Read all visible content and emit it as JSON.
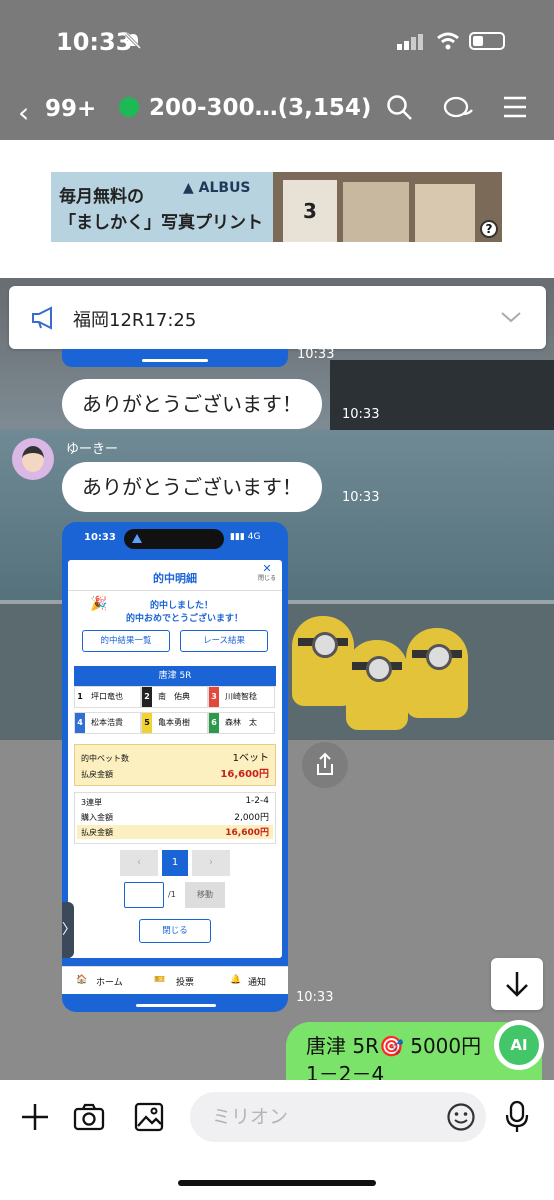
{
  "status_bar": {
    "time": "10:33"
  },
  "header": {
    "back_count": "99+",
    "title": "200-300…(3,154)"
  },
  "ad": {
    "line1": "毎月無料の",
    "line2": "「ましかく」写真プリント",
    "brand": "ALBUS",
    "calendar_day": "3",
    "help": "?"
  },
  "announcement": {
    "text": "福岡12R17:25"
  },
  "messages": [
    {
      "time": "10:33"
    },
    {
      "text": "ありがとうございます！",
      "time": "10:33"
    },
    {
      "sender": "ゆーきー",
      "text": "ありがとうございます！",
      "time": "10:33"
    }
  ],
  "screenshot": {
    "time": "10:33",
    "network": "4G",
    "title": "的中明細",
    "close_x": "✕",
    "close_small": "閉じる",
    "hit_line1": "的中しました！",
    "hit_line2": "的中おめでとうございます！",
    "btn_results": "的中結果一覧",
    "btn_race": "レース結果",
    "race": "唐津 5R",
    "racers": [
      {
        "num": "1",
        "name": "坪口竜也",
        "color": "#ffffff",
        "text": "#111"
      },
      {
        "num": "2",
        "name": "南　佑典",
        "color": "#222222",
        "text": "#fff"
      },
      {
        "num": "3",
        "name": "川崎智稔",
        "color": "#e2483c",
        "text": "#fff"
      },
      {
        "num": "4",
        "name": "松本浩貴",
        "color": "#2f6fd6",
        "text": "#fff"
      },
      {
        "num": "5",
        "name": "亀本勇樹",
        "color": "#f2d22e",
        "text": "#111"
      },
      {
        "num": "6",
        "name": "森林　太",
        "color": "#2c9a4a",
        "text": "#fff"
      }
    ],
    "bet_count_label": "的中ベット数",
    "bet_count": "1ベット",
    "payout_label": "払戻金額",
    "payout": "16,600円",
    "bet_type": "3連単",
    "combination": "1-2-4",
    "purchase_label": "購入金額",
    "purchase": "2,000円",
    "payout2_label": "払戻金額",
    "payout2": "16,600円",
    "page_current": "1",
    "page_prev": "‹",
    "page_next": "›",
    "page_of": "/1",
    "move_btn": "移動",
    "close_btn": "閉じる",
    "tab_arrow": "〉",
    "nav_home": "ホーム",
    "nav_vote": "投票",
    "nav_notice": "通知",
    "msg_time": "10:33"
  },
  "outgoing": {
    "line1": "唐津 5R🎯 5000円",
    "line2": "1－2－4"
  },
  "ai_label": "AI",
  "input": {
    "placeholder": "ミリオン"
  }
}
